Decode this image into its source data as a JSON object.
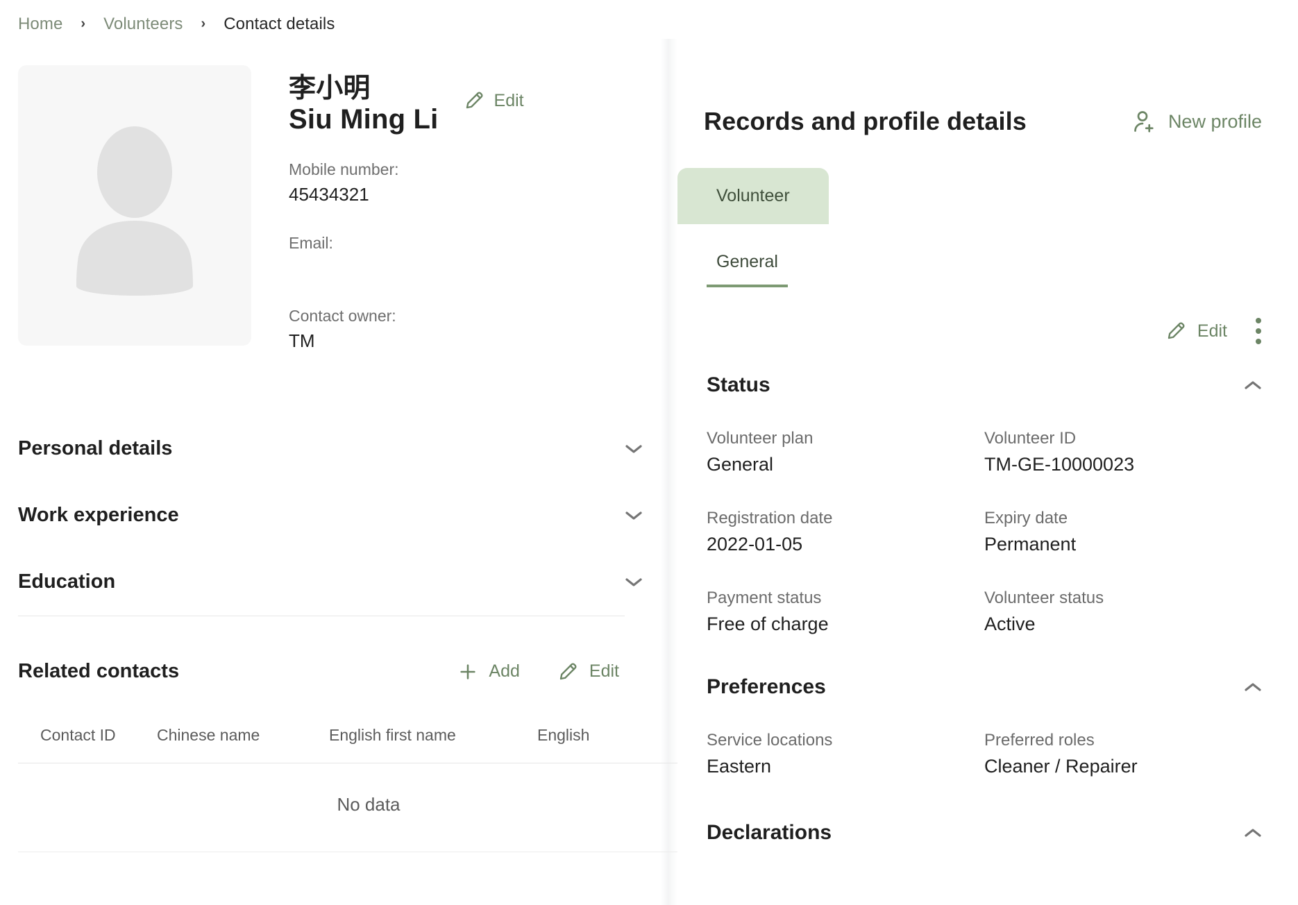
{
  "breadcrumb": {
    "items": [
      {
        "label": "Home",
        "active": false
      },
      {
        "label": "Volunteers",
        "active": false
      },
      {
        "label": "Contact details",
        "active": true
      }
    ],
    "separator": "›"
  },
  "colors": {
    "accent_green": "#6c8565",
    "tab_green_bg": "#d8e6d2",
    "tab_underline": "#7d9a73",
    "text_primary": "#1f1f1f",
    "text_muted": "#6b6b6b",
    "breadcrumb_muted": "#7d8b78",
    "avatar_bg": "#f7f7f7",
    "avatar_shape": "#e0e0e0",
    "divider": "#e6e6e6"
  },
  "profile": {
    "avatar_icon": "person-placeholder-icon",
    "name_chinese": "李小明",
    "name_english": "Siu Ming Li",
    "edit_label": "Edit",
    "fields": [
      {
        "label": "Mobile number:",
        "value": "45434321"
      },
      {
        "label": "Email:",
        "value": ""
      },
      {
        "label": "Contact owner:",
        "value": "TM"
      }
    ]
  },
  "accordions": [
    {
      "title": "Personal details",
      "expanded": false
    },
    {
      "title": "Work experience",
      "expanded": false
    },
    {
      "title": "Education",
      "expanded": false
    }
  ],
  "related_contacts": {
    "title": "Related contacts",
    "add_label": "Add",
    "edit_label": "Edit",
    "columns": [
      "Contact ID",
      "Chinese name",
      "English first name",
      "English"
    ],
    "empty_text": "No data",
    "rows": []
  },
  "records": {
    "title": "Records and profile details",
    "new_profile_label": "New profile",
    "tabs": [
      {
        "label": "Volunteer",
        "active": true
      }
    ],
    "subtabs": [
      {
        "label": "General",
        "active": true
      }
    ],
    "toolbar": {
      "edit_label": "Edit",
      "more_label": "more-options"
    },
    "sections": [
      {
        "title": "Status",
        "expanded": true,
        "fields": [
          {
            "label": "Volunteer plan",
            "value": "General"
          },
          {
            "label": "Volunteer ID",
            "value": "TM-GE-10000023"
          },
          {
            "label": "Registration date",
            "value": "2022-01-05"
          },
          {
            "label": "Expiry date",
            "value": "Permanent"
          },
          {
            "label": "Payment status",
            "value": "Free of charge"
          },
          {
            "label": "Volunteer status",
            "value": "Active"
          }
        ]
      },
      {
        "title": "Preferences",
        "expanded": true,
        "fields": [
          {
            "label": "Service locations",
            "value": "Eastern"
          },
          {
            "label": "Preferred roles",
            "value": "Cleaner / Repairer"
          }
        ]
      },
      {
        "title": "Declarations",
        "expanded": true,
        "fields": []
      }
    ]
  }
}
